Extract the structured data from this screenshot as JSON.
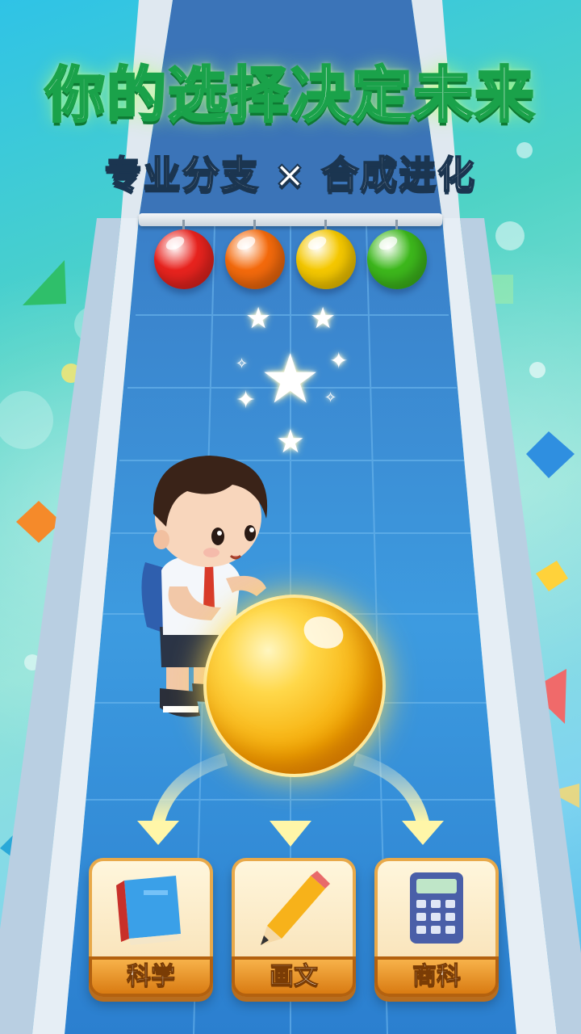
{
  "header": {
    "title": "你的选择决定未来",
    "subtitle": "专业分支 × 合成进化"
  },
  "orbs": [
    {
      "color": "#e8231e",
      "name": "red-orb"
    },
    {
      "color": "#f46a0c",
      "name": "orange-orb"
    },
    {
      "color": "#f5c800",
      "name": "yellow-orb"
    },
    {
      "color": "#3db81c",
      "name": "green-orb"
    }
  ],
  "choices": [
    {
      "label": "科学",
      "icon": "book-icon"
    },
    {
      "label": "画文",
      "icon": "pencil-icon"
    },
    {
      "label": "商科",
      "icon": "calculator-icon"
    }
  ],
  "colors": {
    "accent": "#f5a800",
    "title_stroke": "#1aa24a",
    "runway": "#2f8fd6"
  }
}
